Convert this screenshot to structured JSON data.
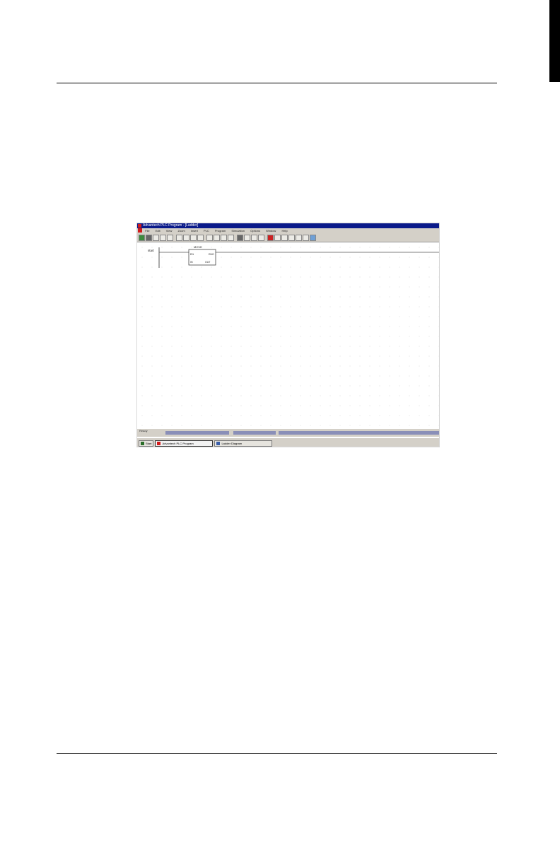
{
  "screenshot": {
    "window_title": "Advantech PLC Program - [Ladder]",
    "menu": [
      "File",
      "Edit",
      "View",
      "Zoom",
      "Insert",
      "PLC",
      "Program",
      "Simulation",
      "Options",
      "Window",
      "Help"
    ],
    "ladder": {
      "rung_label": "start",
      "block_title": "MOVE",
      "block_in_label": "EN",
      "block_out_label": "ENO",
      "block_src": "IN",
      "block_dst": "OUT"
    },
    "status_label": "Ready",
    "taskbar": {
      "start_label": "Start",
      "tasks": [
        "Advantech PLC Program",
        "Ladder Diagram"
      ]
    },
    "colors": {
      "title_bar": "#0a1a8a",
      "chrome": "#d4d0c8",
      "app_icon": "#d21b1b"
    }
  }
}
